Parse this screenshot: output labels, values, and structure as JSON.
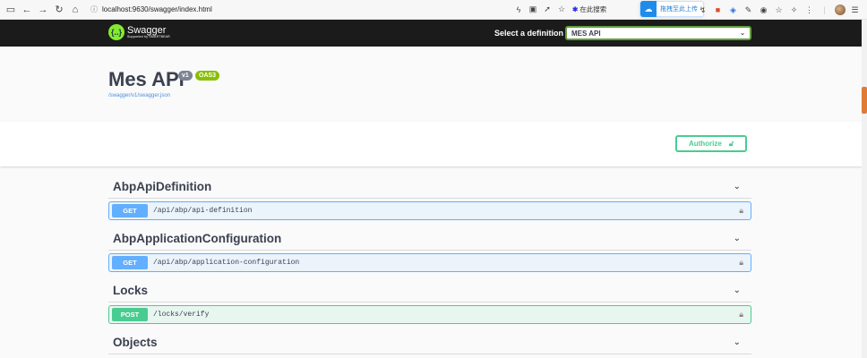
{
  "browser": {
    "url": "localhost:9630/swagger/index.html",
    "search_label": "在此搜索",
    "upload_label": "拖拽至此上传"
  },
  "header": {
    "logo_name": "Swagger",
    "logo_sub": "Supported by SMARTBEAR",
    "definition_label": "Select a definition",
    "definition_value": "MES API"
  },
  "info": {
    "title": "Mes API",
    "version": "v1",
    "oas": "OAS3",
    "spec_url": "/swagger/v1/swagger.json"
  },
  "auth": {
    "label": "Authorize"
  },
  "groups": [
    {
      "name": "AbpApiDefinition",
      "ops": [
        {
          "method": "GET",
          "path": "/api/abp/api-definition"
        }
      ]
    },
    {
      "name": "AbpApplicationConfiguration",
      "ops": [
        {
          "method": "GET",
          "path": "/api/abp/application-configuration"
        }
      ]
    },
    {
      "name": "Locks",
      "ops": [
        {
          "method": "POST",
          "path": "/locks/verify"
        }
      ]
    },
    {
      "name": "Objects",
      "ops": []
    }
  ],
  "colors": {
    "get": "#61affe",
    "post": "#49cc90",
    "header_bg": "#1b1b1b",
    "accent": "#89bf04"
  }
}
